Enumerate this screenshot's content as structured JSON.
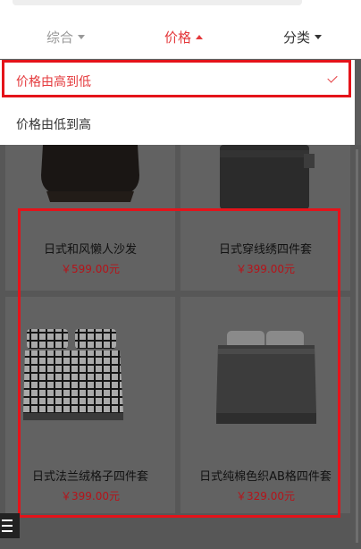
{
  "sort_bar": {
    "general_label": "综合",
    "price_label": "价格",
    "category_label": "分类"
  },
  "dropdown": {
    "selected_option": "价格由高到低",
    "other_option": "价格由低到高"
  },
  "products": [
    {
      "name": "日式和风懒人沙发",
      "price": "￥599.00元"
    },
    {
      "name": "日式穿线绣四件套",
      "price": "￥399.00元"
    },
    {
      "name": "日式法兰绒格子四件套",
      "price": "￥399.00元"
    },
    {
      "name": "日式纯棉色织AB格四件套",
      "price": "￥329.00元"
    }
  ],
  "colors": {
    "accent": "#e4393c",
    "highlight": "#e4131a",
    "overlay": "#5c5c5c"
  },
  "icons": {
    "tab_caret": "caret-down-icon",
    "active_caret": "caret-up-icon",
    "selected_mark": "check-icon",
    "menu": "hamburger-menu-icon"
  }
}
